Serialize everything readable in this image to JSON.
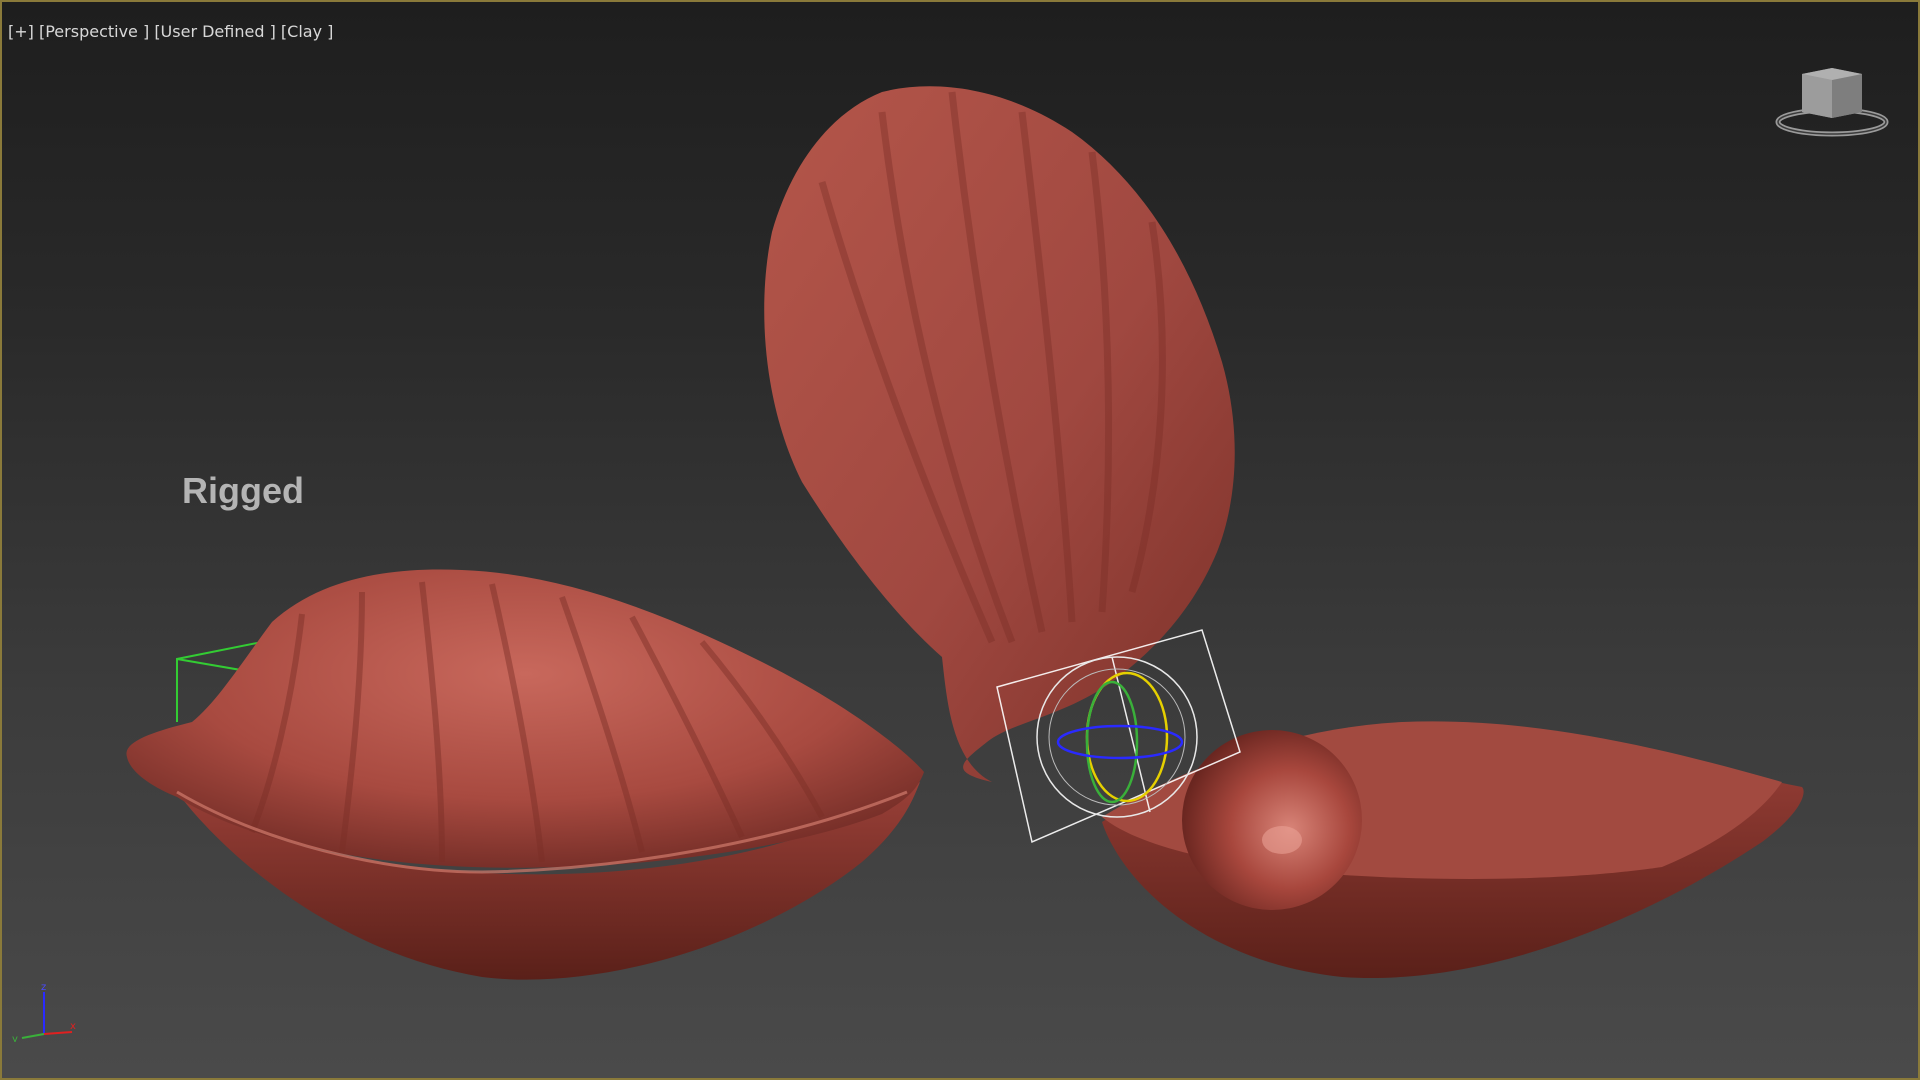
{
  "viewport": {
    "menu_plus": "[+]",
    "view_name": "[Perspective ]",
    "view_mode": "[User Defined ]",
    "shading": "[Clay ]"
  },
  "scene_label": "Rigged",
  "axes": {
    "x": "x",
    "y": "y",
    "z": "z"
  },
  "colors": {
    "shell": "#a84a40",
    "shell_dark": "#6e2a24",
    "shell_light": "#c8685c",
    "frame": "#8a7a3a",
    "bbox_green": "#33cc33",
    "gizmo_white": "#ffffff",
    "gizmo_yellow": "#e6d000",
    "gizmo_green": "#3ab03a",
    "gizmo_blue": "#2a2aff",
    "gizmo_red": "#e02020"
  },
  "icons": {
    "viewcube": "viewcube-icon",
    "tripod": "axis-tripod-icon",
    "gizmo": "rotate-gizmo-icon"
  }
}
